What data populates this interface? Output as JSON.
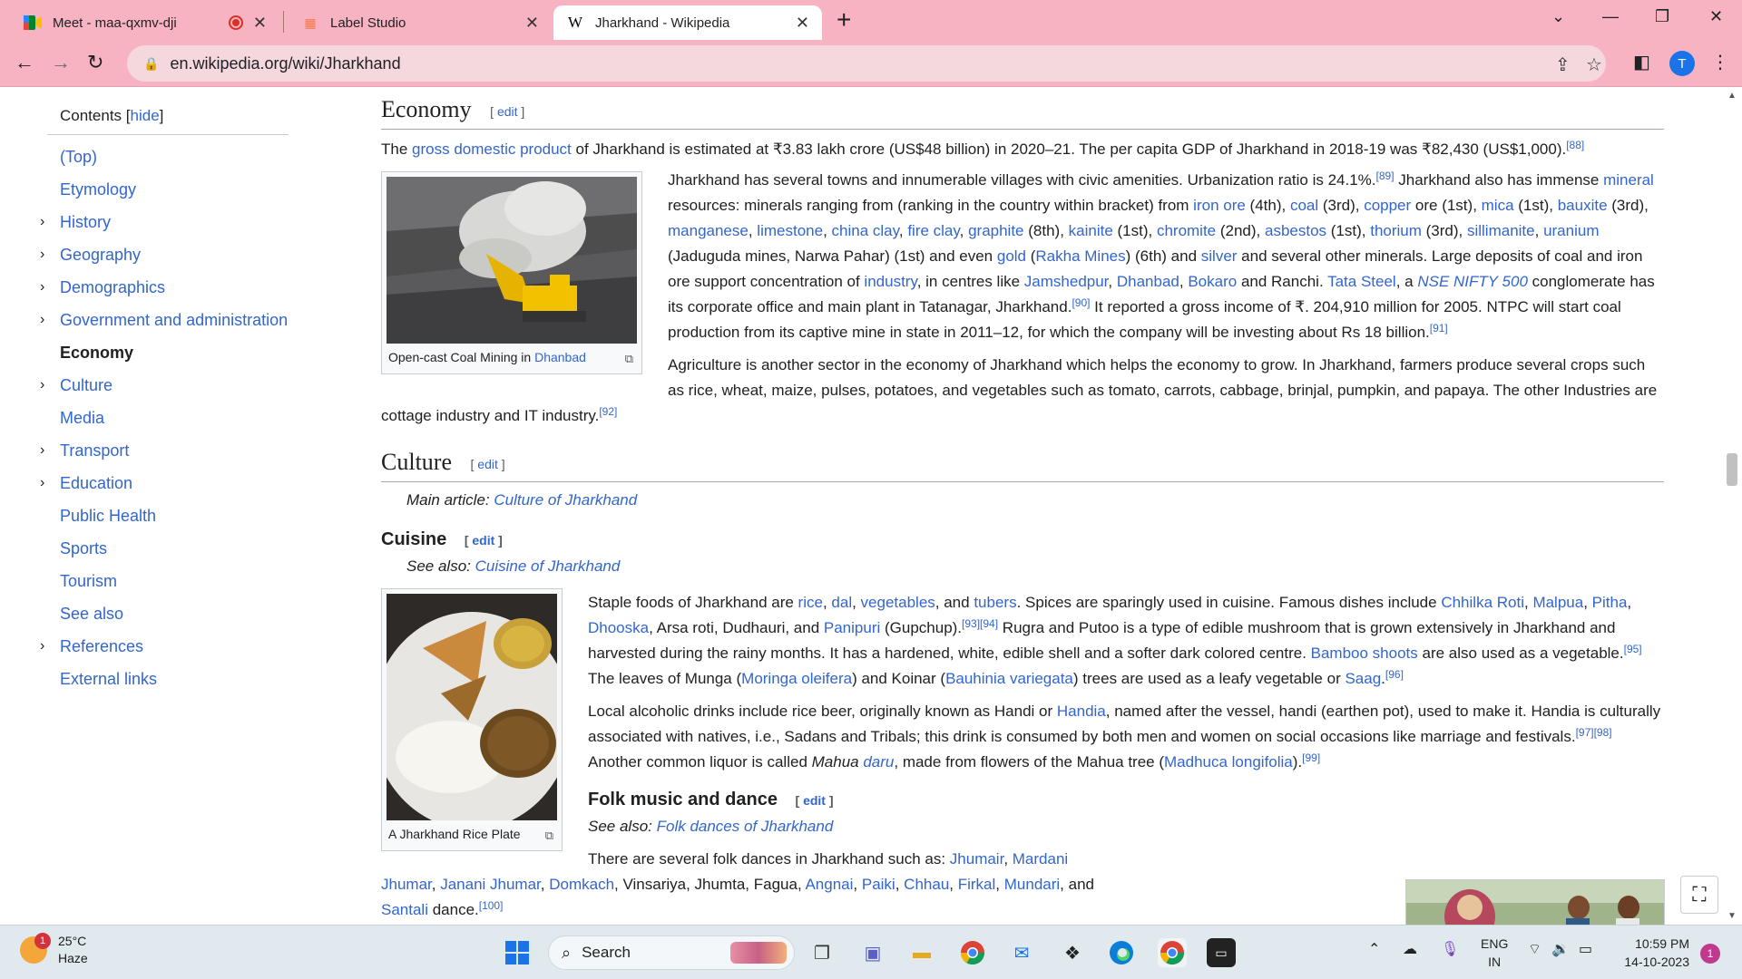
{
  "browser": {
    "tabs": [
      {
        "title": "Meet - maa-qxmv-dji",
        "icon": "google-meet-icon",
        "recording": true
      },
      {
        "title": "Label Studio",
        "icon": "label-studio-icon"
      },
      {
        "title": "Jharkhand - Wikipedia",
        "icon": "wikipedia-icon",
        "active": true
      }
    ],
    "url": "en.wikipedia.org/wiki/Jharkhand",
    "profile_initial": "T"
  },
  "toc": {
    "title": "Contents",
    "hide_label": "hide",
    "items": [
      {
        "label": "(Top)",
        "expandable": false
      },
      {
        "label": "Etymology",
        "expandable": false
      },
      {
        "label": "History",
        "expandable": true
      },
      {
        "label": "Geography",
        "expandable": true
      },
      {
        "label": "Demographics",
        "expandable": true
      },
      {
        "label": "Government and administration",
        "expandable": true
      },
      {
        "label": "Economy",
        "expandable": false,
        "current": true
      },
      {
        "label": "Culture",
        "expandable": true
      },
      {
        "label": "Media",
        "expandable": false
      },
      {
        "label": "Transport",
        "expandable": true
      },
      {
        "label": "Education",
        "expandable": true
      },
      {
        "label": "Public Health",
        "expandable": false
      },
      {
        "label": "Sports",
        "expandable": false
      },
      {
        "label": "Tourism",
        "expandable": false
      },
      {
        "label": "See also",
        "expandable": false
      },
      {
        "label": "References",
        "expandable": true
      },
      {
        "label": "External links",
        "expandable": false
      }
    ]
  },
  "article": {
    "edit_label": "edit",
    "economy": {
      "heading": "Economy",
      "para1": {
        "pre": "The ",
        "link": "gross domestic product",
        "post": " of Jharkhand is estimated at ₹3.83 lakh crore (US$48 billion) in 2020–21. The per capita GDP of Jharkhand in 2018-19 was ₹82,430 (US$1,000).",
        "ref": "[88]"
      },
      "image_caption_pre": "Open-cast Coal Mining in ",
      "image_caption_link": "Dhanbad",
      "para2": [
        {
          "t": "Jharkhand has several towns and innumerable villages with civic amenities. Urbanization ratio is 24.1%."
        },
        {
          "r": "[89]"
        },
        {
          "t": " Jharkhand also has immense "
        },
        {
          "l": "mineral"
        },
        {
          "t": " resources: minerals ranging from (ranking in the country within bracket) from "
        },
        {
          "l": "iron ore"
        },
        {
          "t": " (4th), "
        },
        {
          "l": "coal"
        },
        {
          "t": " (3rd), "
        },
        {
          "l": "copper"
        },
        {
          "t": " ore (1st), "
        },
        {
          "l": "mica"
        },
        {
          "t": " (1st), "
        },
        {
          "l": "bauxite"
        },
        {
          "t": " (3rd), "
        },
        {
          "l": "manganese"
        },
        {
          "t": ", "
        },
        {
          "l": "limestone"
        },
        {
          "t": ", "
        },
        {
          "l": "china clay"
        },
        {
          "t": ", "
        },
        {
          "l": "fire clay"
        },
        {
          "t": ", "
        },
        {
          "l": "graphite"
        },
        {
          "t": " (8th), "
        },
        {
          "l": "kainite"
        },
        {
          "t": " (1st), "
        },
        {
          "l": "chromite"
        },
        {
          "t": " (2nd), "
        },
        {
          "l": "asbestos"
        },
        {
          "t": " (1st), "
        },
        {
          "l": "thorium"
        },
        {
          "t": " (3rd), "
        },
        {
          "l": "sillimanite"
        },
        {
          "t": ", "
        },
        {
          "l": "uranium"
        },
        {
          "t": " (Jaduguda mines, Narwa Pahar) (1st) and even "
        },
        {
          "l": "gold"
        },
        {
          "t": " ("
        },
        {
          "l": "Rakha Mines"
        },
        {
          "t": ") (6th) and "
        },
        {
          "l": "silver"
        },
        {
          "t": " and several other minerals. Large deposits of coal and iron ore support concentration of "
        },
        {
          "l": "industry"
        },
        {
          "t": ", in centres like "
        },
        {
          "l": "Jamshedpur"
        },
        {
          "t": ", "
        },
        {
          "l": "Dhanbad"
        },
        {
          "t": ", "
        },
        {
          "l": "Bokaro"
        },
        {
          "t": " and Ranchi. "
        },
        {
          "l": "Tata Steel"
        },
        {
          "t": ", a "
        },
        {
          "li": "NSE NIFTY 500"
        },
        {
          "t": " conglomerate has its corporate office and main plant in Tatanagar, Jharkhand."
        },
        {
          "r": "[90]"
        },
        {
          "t": " It reported a gross income of ₹. 204,910 million for 2005. NTPC will start coal production from its captive mine in state in 2011–12, for which the company will be investing about Rs 18 billion."
        },
        {
          "r": "[91]"
        }
      ],
      "para3": "Agriculture is another sector in the economy of Jharkhand which helps the economy to grow. In Jharkhand, farmers produce several crops such as rice, wheat, maize, pulses, potatoes, and vegetables such as tomato, carrots, cabbage, brinjal, pumpkin, and papaya. The other Industries are cottage industry and IT industry.",
      "para3_ref": "[92]"
    },
    "culture": {
      "heading": "Culture",
      "main_article_label": "Main article: ",
      "main_article_link": "Culture of Jharkhand"
    },
    "cuisine": {
      "heading": "Cuisine",
      "see_also_label": "See also: ",
      "see_also_link": "Cuisine of Jharkhand",
      "image_caption": "A Jharkhand Rice Plate",
      "para1": [
        {
          "t": "Staple foods of Jharkhand are "
        },
        {
          "l": "rice"
        },
        {
          "t": ", "
        },
        {
          "l": "dal"
        },
        {
          "t": ", "
        },
        {
          "l": "vegetables"
        },
        {
          "t": ", and "
        },
        {
          "l": "tubers"
        },
        {
          "t": ". Spices are sparingly used in cuisine. Famous dishes include "
        },
        {
          "l": "Chhilka Roti"
        },
        {
          "t": ", "
        },
        {
          "l": "Malpua"
        },
        {
          "t": ", "
        },
        {
          "l": "Pitha"
        },
        {
          "t": ", "
        },
        {
          "l": "Dhooska"
        },
        {
          "t": ", Arsa roti, Dudhauri, and "
        },
        {
          "l": "Panipuri"
        },
        {
          "t": " (Gupchup)."
        },
        {
          "r": "[93]"
        },
        {
          "r": "[94]"
        },
        {
          "t": " Rugra and Putoo is a type of edible mushroom that is grown extensively in Jharkhand and harvested during the rainy months. It has a hardened, white, edible shell and a softer dark colored centre. "
        },
        {
          "l": "Bamboo shoots"
        },
        {
          "t": " are also used as a vegetable."
        },
        {
          "r": "[95]"
        },
        {
          "t": " The leaves of Munga ("
        },
        {
          "l": "Moringa oleifera"
        },
        {
          "t": ") and Koinar ("
        },
        {
          "l": "Bauhinia variegata"
        },
        {
          "t": ") trees are used as a leafy vegetable or "
        },
        {
          "l": "Saag"
        },
        {
          "t": "."
        },
        {
          "r": "[96]"
        }
      ],
      "para2": [
        {
          "t": "Local alcoholic drinks include rice beer, originally known as Handi or "
        },
        {
          "l": "Handia"
        },
        {
          "t": ", named after the vessel, handi (earthen pot), used to make it. Handia is culturally associated with natives, i.e., Sadans and Tribals; this drink is consumed by both men and women on social occasions like marriage and festivals."
        },
        {
          "r": "[97]"
        },
        {
          "r": "[98]"
        },
        {
          "t": " Another common liquor is called "
        },
        {
          "i": "Mahua"
        },
        {
          "t": " "
        },
        {
          "li": "daru"
        },
        {
          "t": ", made from flowers of the Mahua tree ("
        },
        {
          "l": "Madhuca longifolia"
        },
        {
          "t": ")."
        },
        {
          "r": "[99]"
        }
      ]
    },
    "folk": {
      "heading": "Folk music and dance",
      "see_also_label": "See also: ",
      "see_also_link": "Folk dances of Jharkhand",
      "para1": [
        {
          "t": "There are several folk dances in Jharkhand such as: "
        },
        {
          "l": "Jhumair"
        },
        {
          "t": ", "
        },
        {
          "l": "Mardani Jhumar"
        },
        {
          "t": ", "
        },
        {
          "l": "Janani Jhumar"
        },
        {
          "t": ", "
        },
        {
          "l": "Domkach"
        },
        {
          "t": ", Vinsariya, Jhumta, Fagua, "
        },
        {
          "l": "Angnai"
        },
        {
          "t": ", "
        },
        {
          "l": "Paiki"
        },
        {
          "t": ", "
        },
        {
          "l": "Chhau"
        },
        {
          "t": ", "
        },
        {
          "l": "Firkal"
        },
        {
          "t": ", "
        },
        {
          "l": "Mundari"
        },
        {
          "t": ", and "
        },
        {
          "l": "Santali"
        },
        {
          "t": " dance."
        },
        {
          "r": "[100]"
        }
      ]
    }
  },
  "taskbar": {
    "weather_temp": "25°C",
    "weather_desc": "Haze",
    "weather_badge": "1",
    "search_label": "Search",
    "lang_line1": "ENG",
    "lang_line2": "IN",
    "time": "10:59 PM",
    "date": "14-10-2023",
    "notification_count": "1"
  }
}
